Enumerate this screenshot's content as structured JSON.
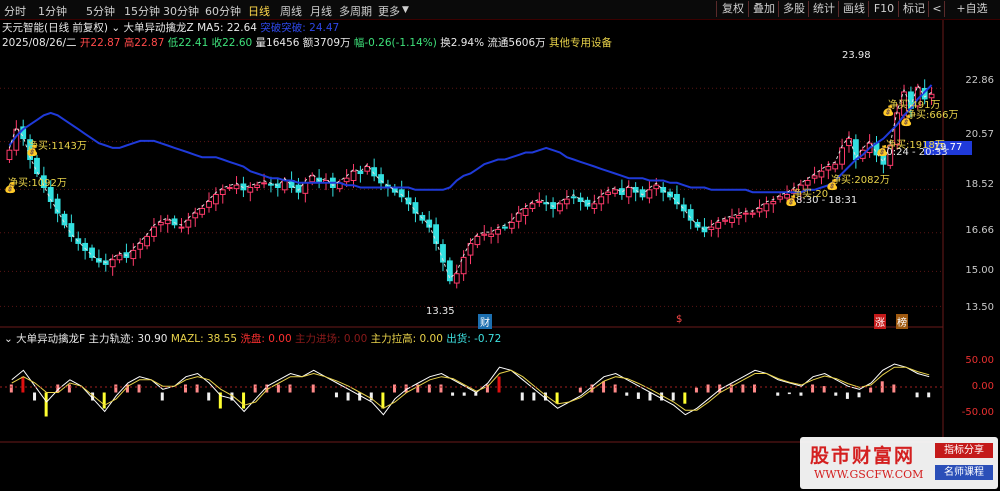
{
  "toolbar": {
    "periods": [
      "分时",
      "1分钟",
      "5分钟",
      "15分钟",
      "30分钟",
      "60分钟",
      "日线",
      "周线",
      "月线",
      "多周期",
      "更多"
    ],
    "active_period": "日线",
    "right_buttons": [
      "复权",
      "叠加",
      "多股",
      "统计",
      "画线",
      "F10",
      "标记",
      "+自选"
    ],
    "back_icon": "arrow-left-icon"
  },
  "stock": {
    "name": "天元智能",
    "mode": "(日线 前复权)",
    "indicator": "大单异动擒龙Z",
    "ma5_label": "MA5: 22.64",
    "breakout_label": "突破突破: 24.47",
    "date": "2025/08/26/二",
    "open": "开22.87",
    "high": "高22.87",
    "low": "低22.41",
    "close": "收22.60",
    "volume": "量16456",
    "amount": "额3709万",
    "change": "幅-0.26(-1.14%)",
    "turnover": "换2.94%",
    "float": "流通5606万",
    "sector": "其他专用设备"
  },
  "y_axis": [
    "22.86",
    "20.57",
    "18.52",
    "16.66",
    "15.00",
    "13.50"
  ],
  "current_price": "19.77",
  "annotations": {
    "high_mark": "23.98",
    "low_mark": "13.35",
    "time_range1": "10:24 - 20:33",
    "time_range2": "8:30 - 18:31",
    "net_buys": [
      "净买:1143万",
      "净买:1092万",
      "净买:2082万",
      "净买:20",
      "净买:1918万",
      "净买:491万",
      "净买:666万"
    ],
    "event_labels": [
      "财",
      "$",
      "涨",
      "榜"
    ]
  },
  "sub_indicator": {
    "name": "大单异动擒龙F",
    "main_track": "主力轨迹: 30.90",
    "mazl": "MAZL: 38.55",
    "xian_pan": "洗盘: 0.00",
    "main_entry": "主力进场: 0.00",
    "main_pull": "主力拉高: 0.00",
    "ship": "出货: -0.72",
    "y_axis": [
      "50.00",
      "0.00",
      "-50.00"
    ]
  },
  "chart_data": {
    "type": "candlestick",
    "ma_color": "#1f3ad9",
    "up_color": "#ff3b6b",
    "down_color": "#33e0e0",
    "close": [
      20.2,
      21.1,
      20.7,
      19.8,
      19.2,
      18.6,
      18.0,
      17.5,
      17.0,
      16.5,
      16.2,
      15.9,
      15.6,
      15.4,
      15.3,
      15.5,
      15.7,
      15.6,
      15.9,
      16.2,
      16.5,
      16.9,
      17.1,
      17.2,
      17.0,
      16.9,
      17.2,
      17.5,
      17.7,
      18.0,
      18.3,
      18.5,
      18.6,
      18.7,
      18.5,
      18.6,
      18.7,
      18.8,
      18.7,
      18.6,
      18.9,
      18.6,
      18.4,
      18.8,
      19.1,
      18.8,
      18.9,
      18.6,
      18.8,
      19.0,
      19.3,
      19.2,
      19.5,
      19.1,
      18.8,
      18.6,
      18.4,
      18.2,
      17.9,
      17.5,
      17.2,
      16.9,
      16.2,
      15.4,
      14.6,
      14.9,
      15.6,
      16.2,
      16.5,
      16.6,
      16.6,
      16.8,
      16.9,
      17.1,
      17.5,
      17.7,
      17.9,
      18.0,
      17.9,
      17.7,
      17.9,
      18.1,
      18.2,
      18.0,
      17.8,
      17.9,
      18.2,
      18.4,
      18.5,
      18.3,
      18.6,
      18.4,
      18.2,
      18.5,
      18.7,
      18.4,
      18.2,
      17.9,
      17.6,
      17.2,
      16.9,
      16.7,
      16.9,
      17.1,
      17.2,
      17.3,
      17.4,
      17.5,
      17.5,
      17.7,
      17.9,
      18.0,
      18.2,
      18.3,
      18.5,
      18.7,
      18.9,
      19.1,
      19.3,
      19.5,
      19.6,
      20.3,
      20.7,
      19.8,
      20.2,
      20.5,
      20.0,
      19.6,
      20.4,
      21.8,
      22.7,
      22.0,
      22.9,
      22.4,
      22.6
    ],
    "ma": [
      20.4,
      20.8,
      21.1,
      21.3,
      21.5,
      21.7,
      21.8,
      21.7,
      21.5,
      21.3,
      21.1,
      20.9,
      20.7,
      20.5,
      20.4,
      20.3,
      20.3,
      20.4,
      20.5,
      20.6,
      20.6,
      20.6,
      20.5,
      20.4,
      20.3,
      20.2,
      20.1,
      20.0,
      19.9,
      19.9,
      19.9,
      19.8,
      19.7,
      19.6,
      19.5,
      19.3,
      19.2,
      19.1,
      19.0,
      19.0,
      18.9,
      18.9,
      18.8,
      18.8,
      18.8,
      18.8,
      18.8,
      18.8,
      18.8,
      18.7,
      18.7,
      18.6,
      18.6,
      18.6,
      18.6,
      18.6,
      18.6,
      18.6,
      18.6,
      18.5,
      18.5,
      18.5,
      18.5,
      18.5,
      18.6,
      18.9,
      19.1,
      19.2,
      19.4,
      19.6,
      19.7,
      19.8,
      19.8,
      19.9,
      20.0,
      20.1,
      20.1,
      20.2,
      20.3,
      20.2,
      20.1,
      19.9,
      19.8,
      19.7,
      19.6,
      19.5,
      19.4,
      19.3,
      19.2,
      19.1,
      19.0,
      19.0,
      19.0,
      18.9,
      18.9,
      18.9,
      18.8,
      18.8,
      18.7,
      18.6,
      18.6,
      18.6,
      18.5,
      18.5,
      18.5,
      18.5,
      18.5,
      18.5,
      18.4,
      18.4,
      18.4,
      18.4,
      18.4,
      18.4,
      18.4,
      18.4,
      18.5,
      18.5,
      18.6,
      18.7,
      18.9,
      19.2,
      19.5,
      19.8,
      20.0,
      20.3,
      20.5,
      20.7,
      21.0,
      21.3,
      21.7,
      22.0,
      22.4,
      22.7,
      23.0
    ],
    "ylim": [
      13.0,
      24.5
    ],
    "oscillator": {
      "line_a": [
        20,
        35,
        10,
        -15,
        5,
        20,
        10,
        -10,
        -30,
        -5,
        15,
        25,
        20,
        5,
        10,
        25,
        30,
        15,
        -5,
        -10,
        -30,
        -10,
        10,
        20,
        30,
        25,
        35,
        25,
        15,
        5,
        -5,
        -15,
        -35,
        -10,
        5,
        15,
        25,
        30,
        20,
        10,
        0,
        15,
        40,
        35,
        20,
        5,
        -10,
        -25,
        -15,
        -5,
        10,
        25,
        30,
        20,
        10,
        0,
        -10,
        -20,
        -35,
        -25,
        -10,
        5,
        15,
        25,
        35,
        30,
        20,
        15,
        10,
        25,
        30,
        20,
        10,
        5,
        15,
        35,
        45,
        40,
        30,
        25
      ],
      "line_b": [
        15,
        25,
        15,
        0,
        0,
        15,
        10,
        -5,
        -20,
        -10,
        10,
        20,
        20,
        10,
        10,
        20,
        25,
        20,
        5,
        -5,
        -20,
        -15,
        5,
        15,
        25,
        25,
        30,
        25,
        18,
        10,
        0,
        -10,
        -25,
        -15,
        0,
        10,
        20,
        25,
        22,
        12,
        2,
        10,
        30,
        35,
        25,
        10,
        -5,
        -18,
        -15,
        -8,
        5,
        18,
        25,
        22,
        14,
        5,
        -5,
        -15,
        -28,
        -28,
        -15,
        0,
        10,
        20,
        30,
        30,
        22,
        16,
        12,
        20,
        26,
        22,
        14,
        8,
        12,
        28,
        40,
        40,
        33,
        28
      ]
    }
  }
}
